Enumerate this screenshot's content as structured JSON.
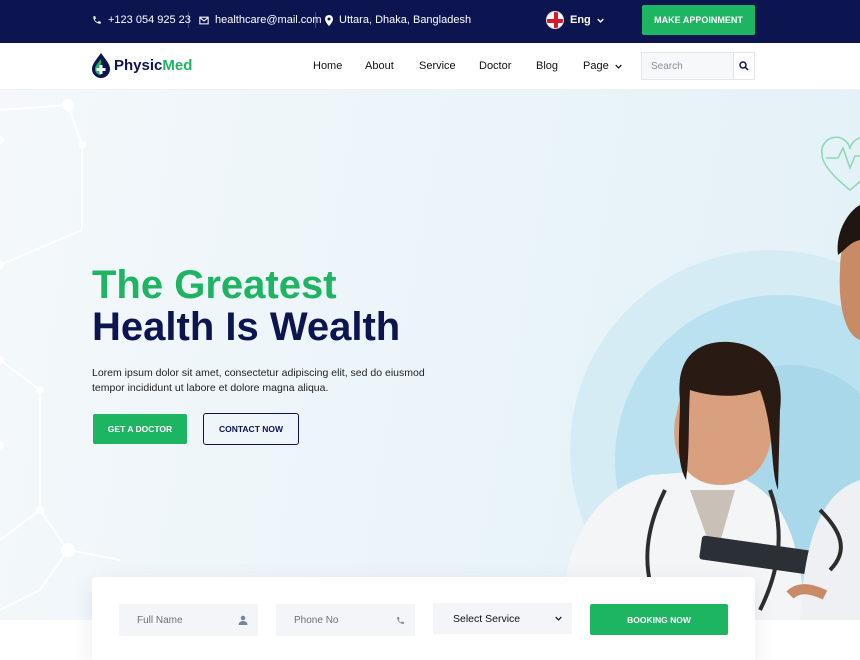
{
  "topbar": {
    "phone": "+123 054 925 23",
    "email": "healthcare@mail.com",
    "address": "Uttara, Dhaka, Bangladesh",
    "language": "Eng",
    "appointment_button": "MAKE APPOINMENT"
  },
  "brand": {
    "logo_part1": "Physic",
    "logo_part2": "Med"
  },
  "nav": {
    "items": [
      "Home",
      "About",
      "Service",
      "Doctor",
      "Blog",
      "Page"
    ],
    "search_placeholder": "Search"
  },
  "hero": {
    "title_line1": "The Greatest",
    "title_line2": "Health Is Wealth",
    "description": "Lorem ipsum dolor sit amet, consectetur adipiscing elit, sed do eiusmod tempor incididunt ut labore et dolore magna aliqua.",
    "primary_button": "GET A DOCTOR",
    "secondary_button": "CONTACT NOW"
  },
  "booking": {
    "name_placeholder": "Full Name",
    "phone_placeholder": "Phone No",
    "service_select": "Select Service",
    "submit_button": "BOOKING NOW"
  },
  "colors": {
    "navy": "#0d1550",
    "green": "#1db462",
    "hero_bg": "#eaf4f9"
  },
  "icons": [
    "phone-icon",
    "mail-icon",
    "location-pin-icon",
    "flag-icon",
    "chevron-down-icon",
    "search-icon",
    "user-icon",
    "phone-small-icon",
    "heart-pulse-icon",
    "cross-drop-logo-icon"
  ]
}
